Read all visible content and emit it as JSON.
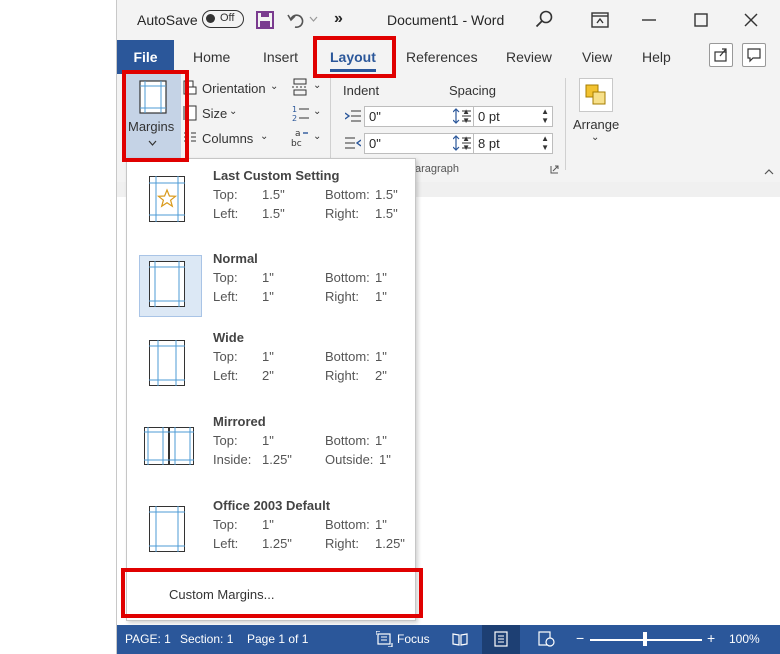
{
  "title_bar": {
    "autosave_label": "AutoSave",
    "autosave_state": "Off",
    "more_glyph": "»",
    "document_title": "Document1 - Word"
  },
  "tabs": {
    "file": "File",
    "home": "Home",
    "insert": "Insert",
    "layout": "Layout",
    "references": "References",
    "review": "Review",
    "view": "View",
    "help": "Help"
  },
  "ribbon": {
    "margins": "Margins",
    "orientation": "Orientation",
    "size": "Size",
    "columns": "Columns",
    "indent": "Indent",
    "spacing": "Spacing",
    "indent_left": "0\"",
    "indent_right": "0\"",
    "spacing_before": "0 pt",
    "spacing_after": "8 pt",
    "arrange": "Arrange",
    "group_paragraph": "aragraph"
  },
  "margins_menu": {
    "options": [
      {
        "name": "Last Custom Setting",
        "r1l": "Top:",
        "r1v": "1.5\"",
        "r1l2": "Bottom:",
        "r1v2": "1.5\"",
        "r2l": "Left:",
        "r2v": "1.5\"",
        "r2l2": "Right:",
        "r2v2": "1.5\""
      },
      {
        "name": "Normal",
        "r1l": "Top:",
        "r1v": "1\"",
        "r1l2": "Bottom:",
        "r1v2": "1\"",
        "r2l": "Left:",
        "r2v": "1\"",
        "r2l2": "Right:",
        "r2v2": "1\""
      },
      {
        "name": "Wide",
        "r1l": "Top:",
        "r1v": "1\"",
        "r1l2": "Bottom:",
        "r1v2": "1\"",
        "r2l": "Left:",
        "r2v": "2\"",
        "r2l2": "Right:",
        "r2v2": "2\""
      },
      {
        "name": "Mirrored",
        "r1l": "Top:",
        "r1v": "1\"",
        "r1l2": "Bottom:",
        "r1v2": "1\"",
        "r2l": "Inside:",
        "r2v": "1.25\"",
        "r2l2": "Outside:",
        "r2v2": "1\""
      },
      {
        "name": "Office 2003 Default",
        "r1l": "Top:",
        "r1v": "1\"",
        "r1l2": "Bottom:",
        "r1v2": "1\"",
        "r2l": "Left:",
        "r2v": "1.25\"",
        "r2l2": "Right:",
        "r2v2": "1.25\""
      }
    ],
    "custom_margins": "Custom Margins..."
  },
  "status_bar": {
    "page": "PAGE: 1",
    "section": "Section: 1",
    "page_of": "Page 1 of 1",
    "focus": "Focus",
    "zoom": "100%",
    "minus": "−",
    "plus": "+"
  },
  "colors": {
    "accent": "#2b579a",
    "highlight": "#e00000"
  }
}
